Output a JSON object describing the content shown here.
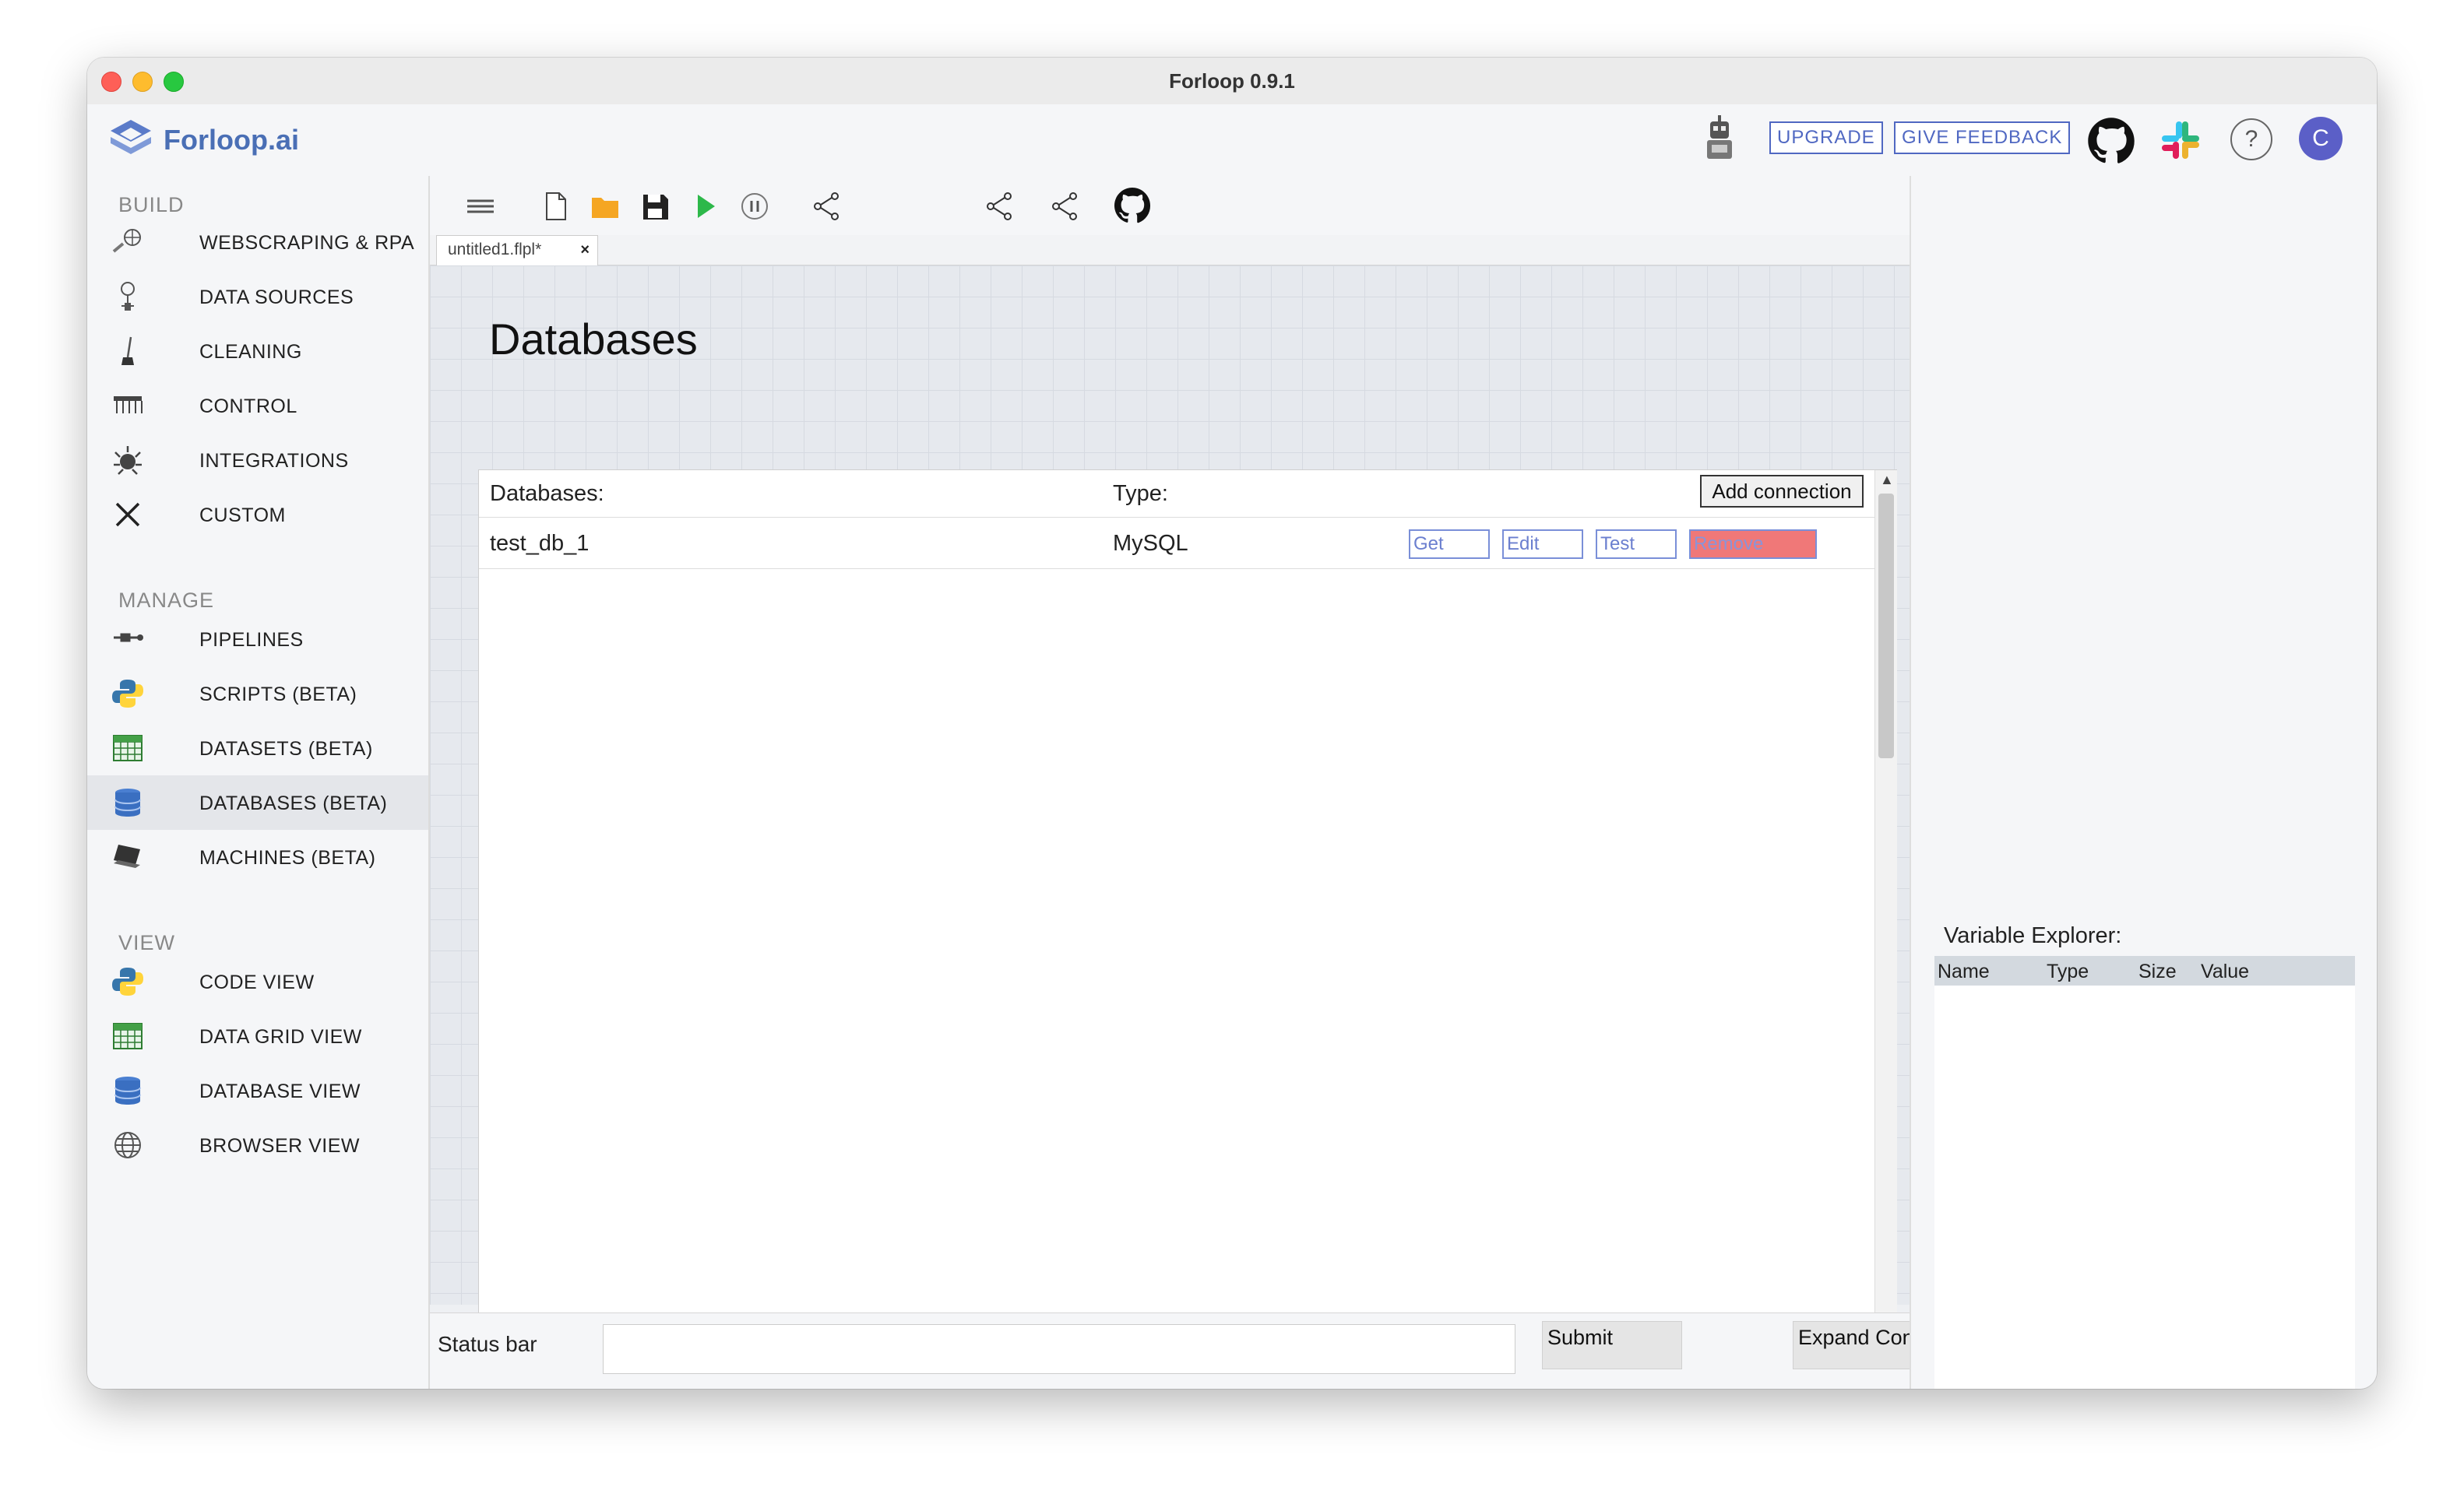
{
  "window": {
    "title": "Forloop 0.9.1"
  },
  "header": {
    "logo_text": "Forloop.ai",
    "upgrade_label": "UPGRADE",
    "feedback_label": "GIVE FEEDBACK",
    "help_label": "?",
    "avatar_initial": "C"
  },
  "sidebar": {
    "build_title": "BUILD",
    "build_items": [
      {
        "label": "WEBSCRAPING & RPA",
        "icon": "webscraping-icon"
      },
      {
        "label": "DATA SOURCES",
        "icon": "data-sources-icon"
      },
      {
        "label": "CLEANING",
        "icon": "broom-icon"
      },
      {
        "label": "CONTROL",
        "icon": "control-icon"
      },
      {
        "label": "INTEGRATIONS",
        "icon": "integrations-icon"
      },
      {
        "label": "CUSTOM",
        "icon": "tools-icon"
      }
    ],
    "manage_title": "MANAGE",
    "manage_items": [
      {
        "label": "PIPELINES",
        "icon": "pipelines-icon"
      },
      {
        "label": "SCRIPTS (BETA)",
        "icon": "python-icon"
      },
      {
        "label": "DATASETS (BETA)",
        "icon": "grid-icon"
      },
      {
        "label": "DATABASES (BETA)",
        "icon": "database-icon",
        "active": true
      },
      {
        "label": "MACHINES (BETA)",
        "icon": "laptop-icon"
      }
    ],
    "view_title": "VIEW",
    "view_items": [
      {
        "label": "CODE VIEW",
        "icon": "python-icon"
      },
      {
        "label": "DATA GRID VIEW",
        "icon": "grid-icon"
      },
      {
        "label": "DATABASE VIEW",
        "icon": "database-icon"
      },
      {
        "label": "BROWSER VIEW",
        "icon": "globe-icon"
      }
    ]
  },
  "tabs": [
    {
      "label": "untitled1.flpl*",
      "close": "×"
    }
  ],
  "main": {
    "title": "Databases",
    "columns": {
      "databases": "Databases:",
      "type": "Type:"
    },
    "add_connection_label": "Add connection",
    "rows": [
      {
        "name": "test_db_1",
        "type": "MySQL",
        "get": "Get",
        "edit": "Edit",
        "test": "Test",
        "remove": "Remove"
      }
    ],
    "help_label": "?"
  },
  "statusbar": {
    "label": "Status bar",
    "input_value": "",
    "submit_label": "Submit",
    "expand_label": "Expand Console"
  },
  "variable_explorer": {
    "title": "Variable Explorer:",
    "columns": [
      "Name",
      "Type",
      "Size",
      "Value"
    ]
  },
  "colors": {
    "accent": "#5068c2",
    "avatar": "#5b5fc7",
    "remove_button": "#f07878",
    "play": "#2db84a",
    "folder": "#f5a623"
  }
}
